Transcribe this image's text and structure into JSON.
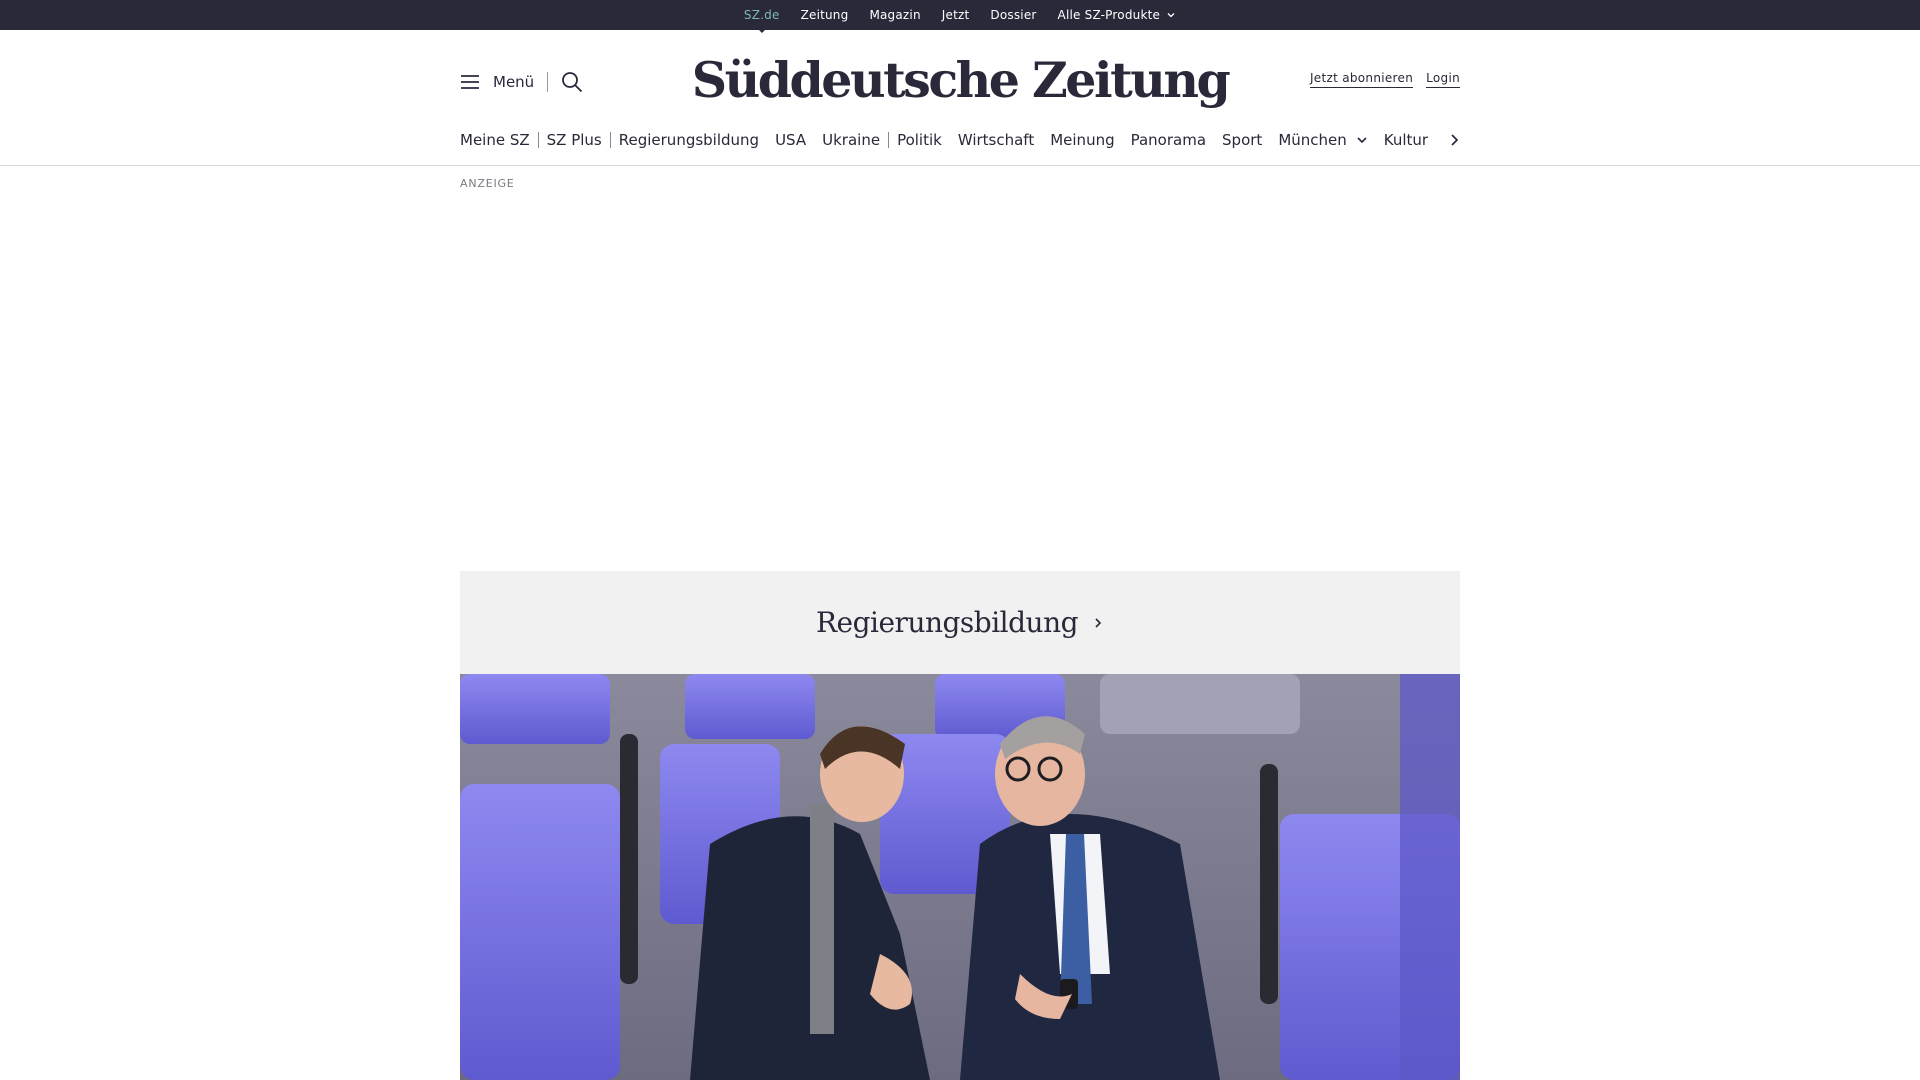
{
  "topbar": {
    "items": [
      {
        "label": "SZ.de",
        "active": true
      },
      {
        "label": "Zeitung"
      },
      {
        "label": "Magazin"
      },
      {
        "label": "Jetzt"
      },
      {
        "label": "Dossier"
      },
      {
        "label": "Alle SZ-Produkte",
        "has_dropdown": true
      }
    ]
  },
  "header": {
    "menu_label": "Menü",
    "logo_text": "Süddeutsche Zeitung",
    "subscribe_label": "Jetzt abonnieren",
    "login_label": "Login"
  },
  "nav": {
    "items": [
      {
        "label": "Meine SZ"
      },
      {
        "label": "SZ Plus"
      },
      {
        "label": "Regierungsbildung"
      },
      {
        "label": "USA"
      },
      {
        "label": "Ukraine"
      },
      {
        "label": "Politik"
      },
      {
        "label": "Wirtschaft"
      },
      {
        "label": "Meinung"
      },
      {
        "label": "Panorama"
      },
      {
        "label": "Sport"
      },
      {
        "label": "München",
        "has_dropdown": true
      },
      {
        "label": "Kultur"
      }
    ]
  },
  "ad": {
    "label": "ANZEIGE"
  },
  "topic": {
    "title": "Regierungsbildung"
  },
  "colors": {
    "topbar_bg": "#29293a",
    "active_link": "#7fb8b4",
    "text": "#29293a",
    "topic_bg": "#f1f1f1",
    "seat_purple": "#7b76e8"
  }
}
